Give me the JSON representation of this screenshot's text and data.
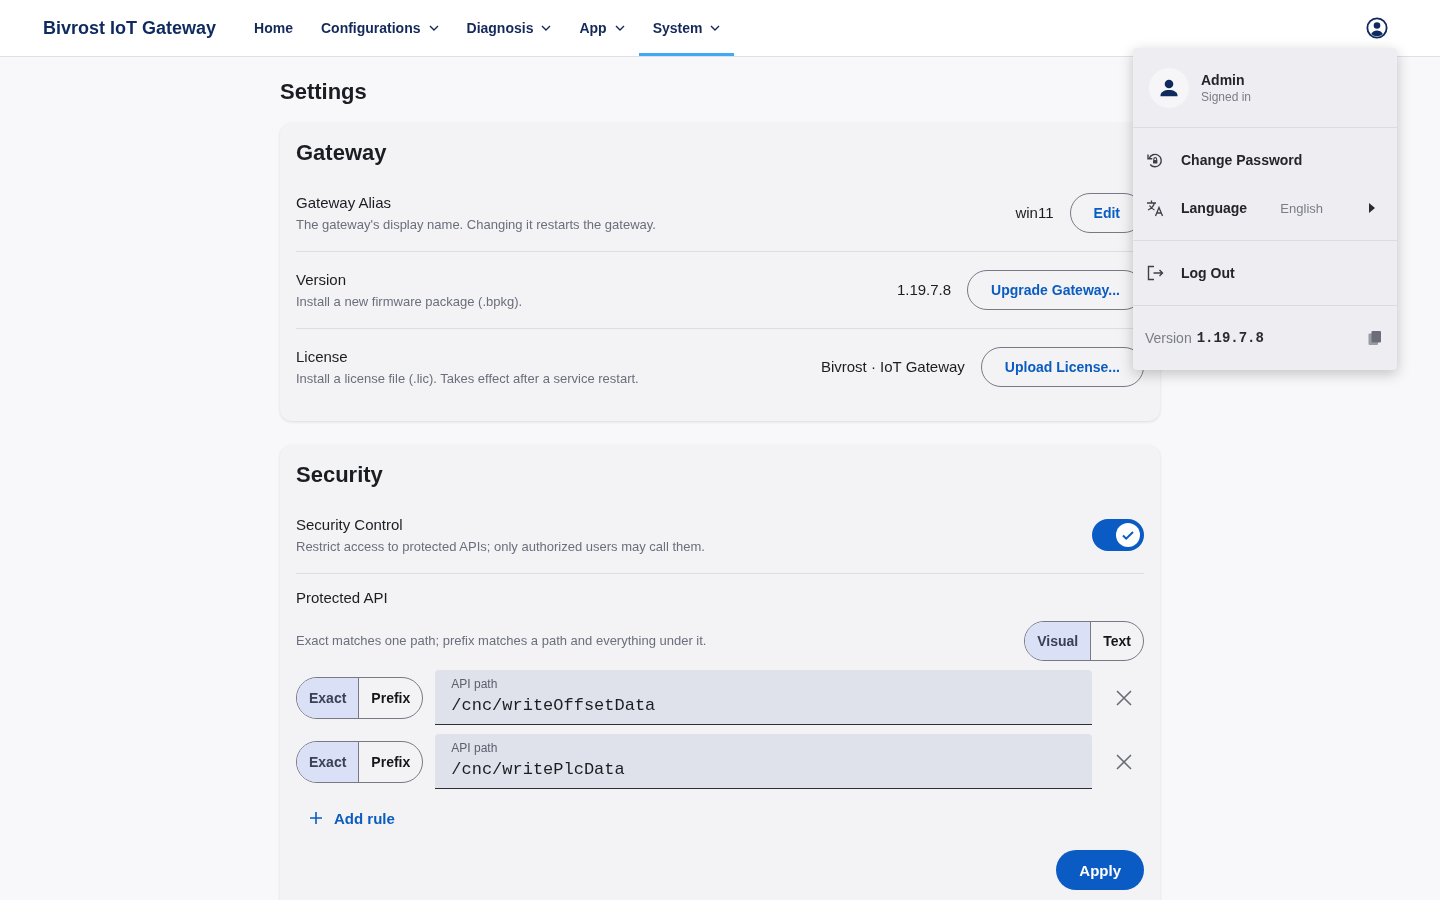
{
  "header": {
    "brand": "Bivrost IoT Gateway",
    "nav": [
      {
        "label": "Home",
        "dropdown": false,
        "selected": false
      },
      {
        "label": "Configurations",
        "dropdown": true,
        "selected": false
      },
      {
        "label": "Diagnosis",
        "dropdown": true,
        "selected": false
      },
      {
        "label": "App",
        "dropdown": true,
        "selected": false
      },
      {
        "label": "System",
        "dropdown": true,
        "selected": true
      }
    ]
  },
  "page_title": "Settings",
  "gateway": {
    "title": "Gateway",
    "rows": [
      {
        "label": "Gateway Alias",
        "description": "The gateway's display name. Changing it restarts the gateway.",
        "value": "win11",
        "action": "Edit"
      },
      {
        "label": "Version",
        "description": "Install a new firmware package (.bpkg).",
        "value": "1.19.7.8",
        "action": "Upgrade Gateway..."
      },
      {
        "label": "License",
        "description": "Install a license file (.lic). Takes effect after a service restart.",
        "value": "Bivrost · IoT Gateway",
        "action": "Upload License..."
      }
    ]
  },
  "security": {
    "title": "Security",
    "control": {
      "label": "Security Control",
      "description": "Restrict access to protected APIs; only authorized users may call them.",
      "on": true
    },
    "protected_api": {
      "label": "Protected API",
      "description": "Exact matches one path; prefix matches a path and everything under it.",
      "modes": [
        {
          "label": "Visual",
          "selected": true
        },
        {
          "label": "Text",
          "selected": false
        }
      ],
      "rules": [
        {
          "match": [
            {
              "label": "Exact",
              "selected": true
            },
            {
              "label": "Prefix",
              "selected": false
            }
          ],
          "field_label": "API path",
          "value": "/cnc/writeOffsetData"
        },
        {
          "match": [
            {
              "label": "Exact",
              "selected": true
            },
            {
              "label": "Prefix",
              "selected": false
            }
          ],
          "field_label": "API path",
          "value": "/cnc/writePlcData"
        }
      ],
      "add_rule": "Add rule"
    },
    "apply": "Apply"
  },
  "user_menu": {
    "name": "Admin",
    "status": "Signed in",
    "groups": [
      [
        {
          "kind": "action",
          "label": "Change Password"
        },
        {
          "kind": "submenu",
          "label": "Language",
          "value": "English"
        }
      ],
      [
        {
          "kind": "action",
          "label": "Log Out"
        }
      ]
    ],
    "version_label": "Version",
    "version": "1.19.7.8"
  }
}
